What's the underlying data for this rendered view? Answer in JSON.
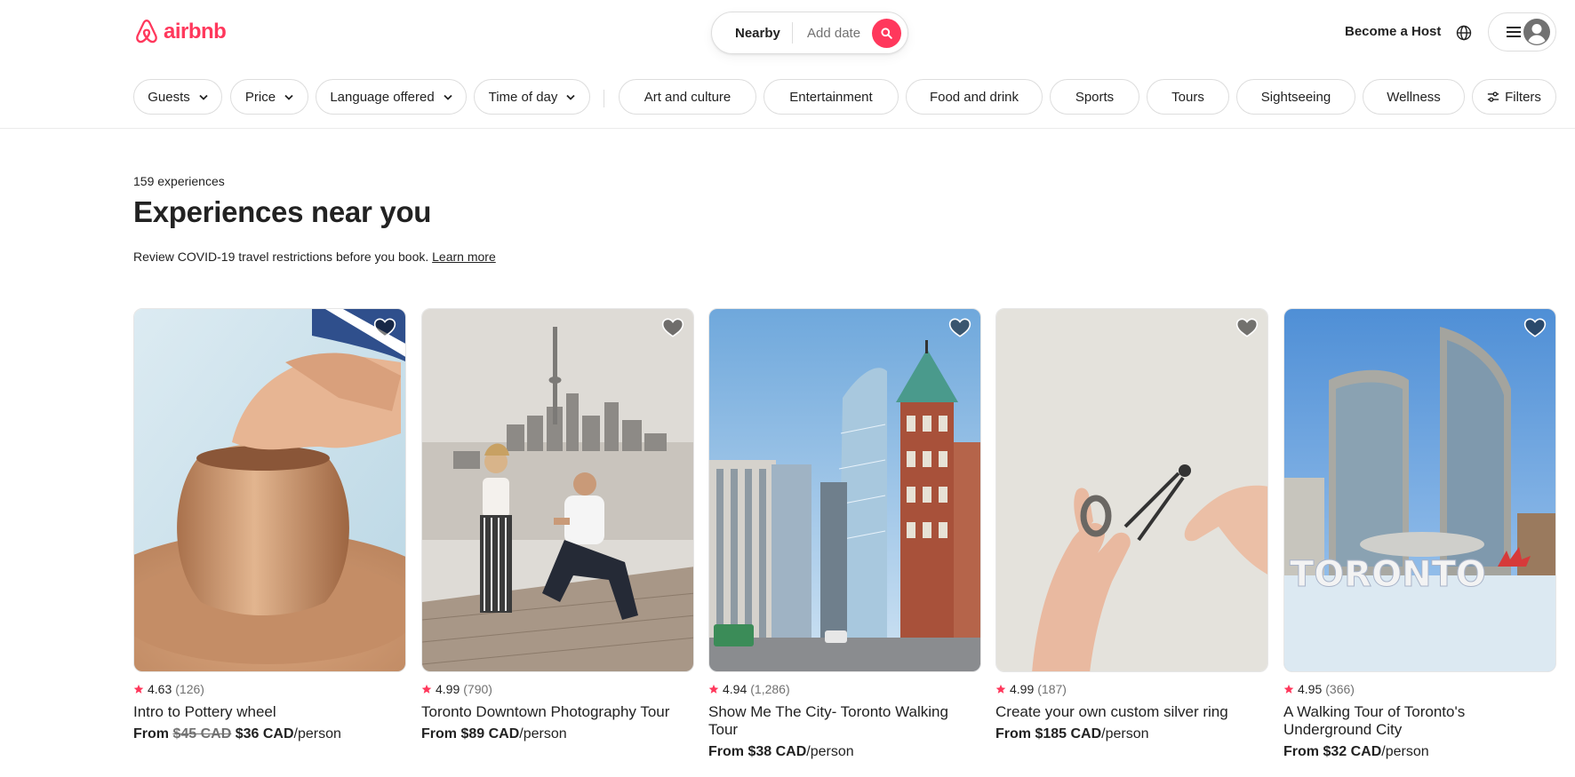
{
  "brand": {
    "name": "airbnb",
    "color": "#ff385c"
  },
  "search": {
    "location": "Nearby",
    "date_placeholder": "Add date"
  },
  "header": {
    "host_link": "Become a Host"
  },
  "filters": {
    "dropdowns": [
      "Guests",
      "Price",
      "Language offered",
      "Time of day"
    ],
    "categories": [
      "Art and culture",
      "Entertainment",
      "Food and drink",
      "Sports",
      "Tours",
      "Sightseeing",
      "Wellness"
    ],
    "filters_label": "Filters"
  },
  "main": {
    "count": "159 experiences",
    "title": "Experiences near you",
    "covid_text": "Review COVID-19 travel restrictions before you book.",
    "covid_link": "Learn more"
  },
  "cards": [
    {
      "rating": "4.63",
      "reviews": "(126)",
      "title": "Intro to Pottery wheel",
      "from": "From",
      "old_price": "$45 CAD",
      "price": "$36 CAD",
      "unit": "/person"
    },
    {
      "rating": "4.99",
      "reviews": "(790)",
      "title": "Toronto Downtown Photography Tour",
      "from": "From",
      "price": "$89 CAD",
      "unit": "/person"
    },
    {
      "rating": "4.94",
      "reviews": "(1,286)",
      "title": "Show Me The City- Toronto Walking Tour",
      "from": "From",
      "price": "$38 CAD",
      "unit": "/person"
    },
    {
      "rating": "4.99",
      "reviews": "(187)",
      "title": "Create your own custom silver ring",
      "from": "From",
      "price": "$185 CAD",
      "unit": "/person"
    },
    {
      "rating": "4.95",
      "reviews": "(366)",
      "title": "A Walking Tour of Toronto's Underground City",
      "from": "From",
      "price": "$32 CAD",
      "unit": "/person"
    }
  ],
  "icons": {
    "logo": "airbnb-logo-icon",
    "search": "search-icon",
    "globe": "globe-icon",
    "menu": "hamburger-menu-icon",
    "avatar": "user-avatar-icon",
    "chevron": "chevron-down-icon",
    "filters": "sliders-icon",
    "heart": "heart-icon",
    "star": "star-icon"
  },
  "colors": {
    "accent": "#ff385c",
    "text": "#222222",
    "muted": "#717171",
    "border": "#dddddd"
  }
}
